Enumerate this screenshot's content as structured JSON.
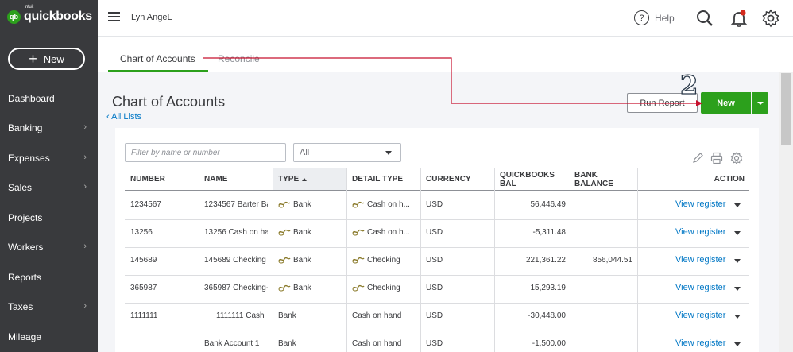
{
  "brand": {
    "logo_mark": "qb",
    "intuit": "intuit",
    "name": "quickbooks"
  },
  "sidebar": {
    "new_label": "New",
    "items": [
      {
        "label": "Dashboard",
        "chevron": false
      },
      {
        "label": "Banking",
        "chevron": true
      },
      {
        "label": "Expenses",
        "chevron": true
      },
      {
        "label": "Sales",
        "chevron": true
      },
      {
        "label": "Projects",
        "chevron": false
      },
      {
        "label": "Workers",
        "chevron": true
      },
      {
        "label": "Reports",
        "chevron": false
      },
      {
        "label": "Taxes",
        "chevron": true
      },
      {
        "label": "Mileage",
        "chevron": false
      }
    ]
  },
  "topbar": {
    "company": "Lyn AngeL",
    "help": "Help",
    "help_glyph": "?"
  },
  "tabs": {
    "active": "Chart of Accounts",
    "secondary": "Reconcile"
  },
  "page": {
    "title": "Chart of Accounts",
    "all_lists": "All Lists",
    "run_report": "Run Report",
    "new": "New",
    "annotation": "2"
  },
  "filter": {
    "placeholder": "Filter by name or number",
    "select_value": "All"
  },
  "table": {
    "headers": [
      "NUMBER",
      "NAME",
      "TYPE",
      "DETAIL TYPE",
      "CURRENCY",
      "QUICKBOOKS BAL",
      "BANK BALANCE",
      "ACTION"
    ],
    "rows": [
      {
        "number": "1234567",
        "name": "1234567 Barter Ba",
        "type": "Bank",
        "detail": "Cash on h...",
        "currency": "USD",
        "qb": "56,446.49",
        "bank": "",
        "action": "View register",
        "icons": true
      },
      {
        "number": "13256",
        "name": "13256 Cash on har",
        "type": "Bank",
        "detail": "Cash on h...",
        "currency": "USD",
        "qb": "-5,311.48",
        "bank": "",
        "action": "View register",
        "icons": true
      },
      {
        "number": "145689",
        "name": "145689 Checking",
        "type": "Bank",
        "detail": "Checking",
        "currency": "USD",
        "qb": "221,361.22",
        "bank": "856,044.51",
        "action": "View register",
        "icons": true
      },
      {
        "number": "365987",
        "name": "365987 Checking-",
        "type": "Bank",
        "detail": "Checking",
        "currency": "USD",
        "qb": "15,293.19",
        "bank": "",
        "action": "View register",
        "icons": true
      },
      {
        "number": "1111111",
        "name": "1111111 Cash",
        "type": "Bank",
        "detail": "Cash on hand",
        "currency": "USD",
        "qb": "-30,448.00",
        "bank": "",
        "action": "View register",
        "icons": false
      },
      {
        "number": "",
        "name": "Bank Account 1",
        "type": "Bank",
        "detail": "Cash on hand",
        "currency": "USD",
        "qb": "-1,500.00",
        "bank": "",
        "action": "View register",
        "icons": false
      }
    ]
  },
  "colors": {
    "sidebar": "#393a3d",
    "brand_green": "#2ca01c",
    "link": "#0077c5",
    "annotation_line": "#c8102e"
  }
}
